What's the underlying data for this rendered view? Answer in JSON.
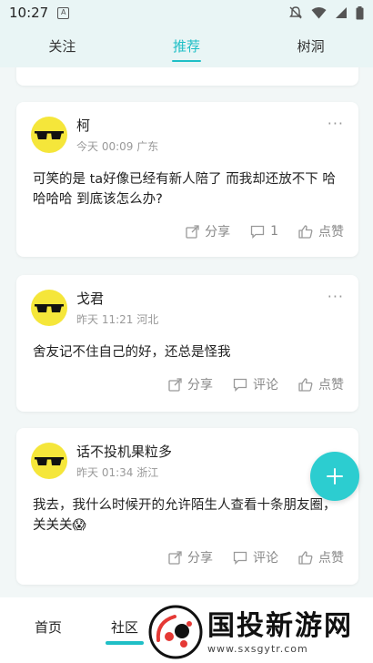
{
  "status_bar": {
    "time": "10:27",
    "app_icon": "A"
  },
  "top_tabs": [
    {
      "label": "关注"
    },
    {
      "label": "推荐"
    },
    {
      "label": "树洞"
    }
  ],
  "posts": [
    {
      "author": "柯",
      "meta": "今天 00:09 广东",
      "text": "可笑的是 ta好像已经有新人陪了 而我却还放不下 哈哈哈哈 到底该怎么办?",
      "share_label": "分享",
      "comment_label": "1",
      "like_label": "点赞"
    },
    {
      "author": "戈君",
      "meta": "昨天 11:21 河北",
      "text": "舍友记不住自己的好，还总是怪我",
      "share_label": "分享",
      "comment_label": "评论",
      "like_label": "点赞"
    },
    {
      "author": "话不投机果粒多",
      "meta": "昨天 01:34 浙江",
      "text": "我去，我什么时候开的允许陌生人查看十条朋友圈，关关关😱",
      "share_label": "分享",
      "comment_label": "评论",
      "like_label": "点赞"
    }
  ],
  "more_label": "···",
  "bottom_nav": [
    {
      "label": "首页"
    },
    {
      "label": "社区"
    }
  ],
  "watermark": {
    "title": "国投新游网",
    "url": "www.sxsgytr.com"
  },
  "colors": {
    "accent": "#1fbfc6",
    "fab": "#2ccdd0",
    "avatar": "#f5e63a"
  }
}
